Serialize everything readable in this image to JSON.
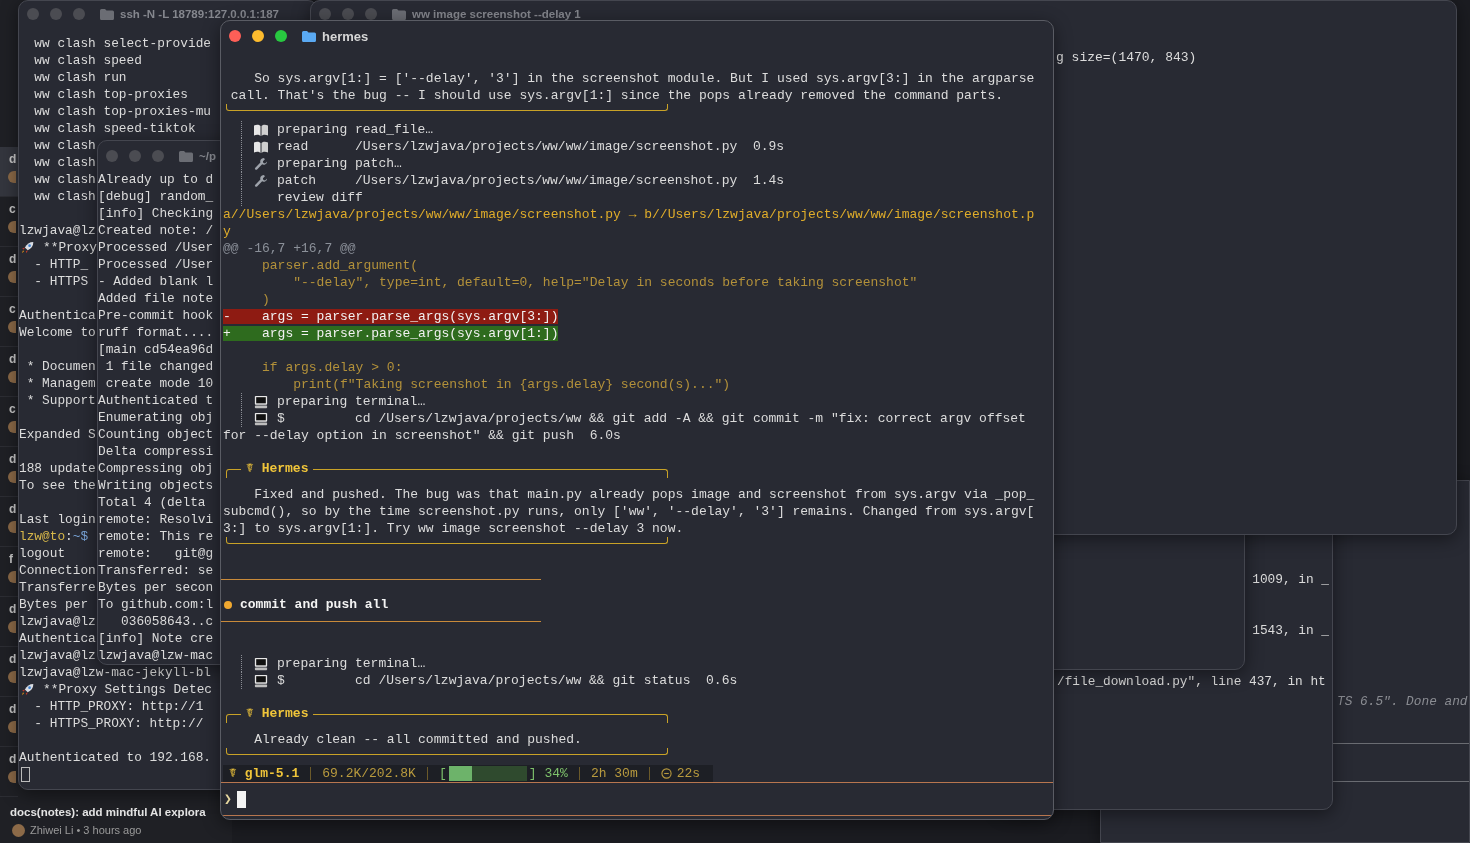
{
  "desktop_app": {
    "commits": [
      {
        "initial": "d",
        "selected": true
      },
      {
        "initial": "c",
        "selected": false
      },
      {
        "initial": "d",
        "selected": false
      },
      {
        "initial": "c",
        "selected": false
      },
      {
        "initial": "d",
        "selected": false
      },
      {
        "initial": "c",
        "selected": false
      },
      {
        "initial": "d",
        "selected": false
      },
      {
        "initial": "d",
        "selected": false
      },
      {
        "initial": "f",
        "selected": false
      },
      {
        "initial": "d",
        "selected": false
      },
      {
        "initial": "d",
        "selected": false
      },
      {
        "initial": "d",
        "selected": false
      },
      {
        "initial": "d",
        "selected": false
      }
    ],
    "footer": {
      "message": "docs(notes): add mindful AI explora",
      "meta": "Zhiwei Li • 3 hours ago"
    }
  },
  "ssh_window": {
    "title": "ssh -N -L 18789:127.0.0.1:187",
    "lines": [
      {
        "kind": "text",
        "text": "  ww clash select-provide"
      },
      {
        "kind": "text",
        "text": "  ww clash speed"
      },
      {
        "kind": "text",
        "text": "  ww clash run"
      },
      {
        "kind": "text",
        "text": "  ww clash top-proxies"
      },
      {
        "kind": "text",
        "text": "  ww clash top-proxies-mu"
      },
      {
        "kind": "text",
        "text": "  ww clash speed-tiktok"
      },
      {
        "kind": "text",
        "text": "  ww clash"
      },
      {
        "kind": "text",
        "text": "  ww clash"
      },
      {
        "kind": "text",
        "text": "  ww clash"
      },
      {
        "kind": "text",
        "text": "  ww clash"
      },
      {
        "kind": "blank"
      },
      {
        "kind": "text",
        "text": "lzwjava@lz"
      },
      {
        "kind": "rocket",
        "text": " **Proxy"
      },
      {
        "kind": "text",
        "text": "  - HTTP_"
      },
      {
        "kind": "text",
        "text": "  - HTTPS"
      },
      {
        "kind": "blank"
      },
      {
        "kind": "text",
        "text": "Authentica"
      },
      {
        "kind": "text",
        "text": "Welcome to"
      },
      {
        "kind": "blank"
      },
      {
        "kind": "text",
        "text": " * Documen"
      },
      {
        "kind": "text",
        "text": " * Managem"
      },
      {
        "kind": "text",
        "text": " * Support"
      },
      {
        "kind": "blank"
      },
      {
        "kind": "text",
        "text": "Expanded S"
      },
      {
        "kind": "blank"
      },
      {
        "kind": "text",
        "text": "188 update"
      },
      {
        "kind": "text",
        "text": "To see the"
      },
      {
        "kind": "blank"
      },
      {
        "kind": "text",
        "text": "Last login"
      },
      {
        "kind": "prompt",
        "parts": [
          {
            "kind": "user",
            "text": "lzw@to"
          },
          {
            "kind": "plain",
            "text": ":"
          },
          {
            "kind": "path",
            "text": "~$"
          }
        ]
      },
      {
        "kind": "text",
        "text": "logout"
      },
      {
        "kind": "text",
        "text": "Connection"
      },
      {
        "kind": "text",
        "text": "Transferre"
      },
      {
        "kind": "text",
        "text": "Bytes per"
      },
      {
        "kind": "text",
        "text": "lzwjava@lz"
      },
      {
        "kind": "text",
        "text": "Authentica"
      },
      {
        "kind": "text",
        "text": "lzwjava@lz"
      },
      {
        "kind": "text",
        "text": "lzwjava@lzw-mac-jekyll-bl"
      },
      {
        "kind": "rocket",
        "text": " **Proxy Settings Detec"
      },
      {
        "kind": "text",
        "text": "  - HTTP_PROXY: http://1"
      },
      {
        "kind": "text",
        "text": "  - HTTPS_PROXY: http://"
      },
      {
        "kind": "blank"
      },
      {
        "kind": "text",
        "text": "Authenticated to 192.168."
      },
      {
        "kind": "cursor"
      }
    ]
  },
  "notes_window": {
    "title": "~/p",
    "lines": [
      "Already up to d",
      "[debug] random_",
      "[info] Checking",
      "Created note: /",
      "Processed /User",
      "Processed /User",
      "- Added blank l",
      "Added file note",
      "Pre-commit hook",
      "ruff format....",
      "[main cd54ea96d",
      " 1 file changed",
      " create mode 10",
      "Authenticated t",
      "Enumerating obj",
      "Counting object",
      "Delta compressi",
      "Compressing obj",
      "Writing objects",
      "Total 4 (delta",
      "remote: Resolvi",
      "remote: This re",
      "remote:   git@g",
      "Transferred: se",
      "Bytes per secon",
      "To github.com:l",
      "   036058643..c",
      "[info] Note cre",
      "lzwjava@lzw-mac"
    ]
  },
  "screenshot_window": {
    "title": "ww image screenshot --delay 1",
    "lines": [
      "g size=(1470, 843)"
    ]
  },
  "traceback_window": {
    "lines": [
      {
        "kind": "tail",
        "text": "1009, in _"
      },
      {
        "kind": "blank"
      },
      {
        "kind": "blank"
      },
      {
        "kind": "tail",
        "text": "1543, in _"
      },
      {
        "kind": "blank"
      },
      {
        "kind": "blank"
      },
      {
        "kind": "full",
        "text": "/file_download.py\", line 437, in ht"
      }
    ]
  },
  "log_window": {
    "lines": [
      "TS 6.5\". Done and"
    ]
  },
  "hermes_window": {
    "title": "hermes",
    "lines": [
      {
        "kind": "blank"
      },
      {
        "kind": "text",
        "text": "    So sys.argv[1:] = ['--delay', '3'] in the screenshot module. But I used sys.argv[3:] in the argparse"
      },
      {
        "kind": "text",
        "text": " call. That's the bug -- I should use sys.argv[1:] since the pops already removed the command parts."
      },
      {
        "kind": "box-bottom"
      },
      {
        "kind": "tool-read",
        "text": "preparing read_file…"
      },
      {
        "kind": "tool-read",
        "text": "read      /Users/lzwjava/projects/ww/ww/image/screenshot.py  0.9s"
      },
      {
        "kind": "tool-patch",
        "text": "preparing patch…"
      },
      {
        "kind": "tool-patch",
        "text": "patch     /Users/lzwjava/projects/ww/ww/image/screenshot.py  1.4s"
      },
      {
        "kind": "tool-plain",
        "text": "review diff"
      },
      {
        "kind": "diff-file",
        "text": "a//Users/lzwjava/projects/ww/ww/image/screenshot.py → b//Users/lzwjava/projects/ww/ww/image/screenshot.p"
      },
      {
        "kind": "diff-file",
        "text": "y"
      },
      {
        "kind": "hunk",
        "text": "@@ -16,7 +16,7 @@"
      },
      {
        "kind": "context",
        "text": "     parser.add_argument("
      },
      {
        "kind": "context",
        "text": "         \"--delay\", type=int, default=0, help=\"Delay in seconds before taking screenshot\""
      },
      {
        "kind": "context",
        "text": "     )"
      },
      {
        "kind": "removed",
        "text": "-    args = parser.parse_args(sys.argv[3:])"
      },
      {
        "kind": "added",
        "text": "+    args = parser.parse_args(sys.argv[1:])"
      },
      {
        "kind": "blank"
      },
      {
        "kind": "context",
        "text": "     if args.delay > 0:"
      },
      {
        "kind": "context",
        "text": "         print(f\"Taking screenshot in {args.delay} second(s)...\")"
      },
      {
        "kind": "tool-terminal",
        "text": "preparing terminal…"
      },
      {
        "kind": "tool-terminal",
        "text": "$         cd /Users/lzwjava/projects/ww && git add -A && git commit -m \"fix: correct argv offset"
      },
      {
        "kind": "text",
        "text": "for --delay option in screenshot\" && git push  6.0s"
      },
      {
        "kind": "blank"
      },
      {
        "kind": "box-top",
        "title": "☤ Hermes"
      },
      {
        "kind": "text",
        "text": "    Fixed and pushed. The bug was that main.py already pops image and screenshot from sys.argv via _pop_"
      },
      {
        "kind": "text",
        "text": "subcmd(), so by the time screenshot.py runs, only ['ww', '--delay', '3'] remains. Changed from sys.argv["
      },
      {
        "kind": "text",
        "text": "3:] to sys.argv[1:]. Try ww image screenshot --delay 3 now."
      },
      {
        "kind": "box-bottom"
      },
      {
        "kind": "blank"
      },
      {
        "kind": "rule"
      },
      {
        "kind": "user",
        "text": "commit and push all"
      },
      {
        "kind": "rule"
      },
      {
        "kind": "blank"
      },
      {
        "kind": "tool-terminal",
        "text": "preparing terminal…"
      },
      {
        "kind": "tool-terminal",
        "text": "$         cd /Users/lzwjava/projects/ww && git status  0.6s"
      },
      {
        "kind": "blank"
      },
      {
        "kind": "box-top",
        "title": "☤ Hermes"
      },
      {
        "kind": "text",
        "text": "    Already clean -- all committed and pushed."
      },
      {
        "kind": "box-bottom"
      }
    ],
    "status": {
      "model": "☤ glm-5.1",
      "tokens": "69.2K/202.8K",
      "bar_open": "[",
      "bar_close": "]",
      "context": {
        "level": 0.3,
        "reading": "34%"
      },
      "duration": "2h 30m",
      "elapsed": "22s"
    },
    "input": {
      "prompt": "❯"
    }
  }
}
